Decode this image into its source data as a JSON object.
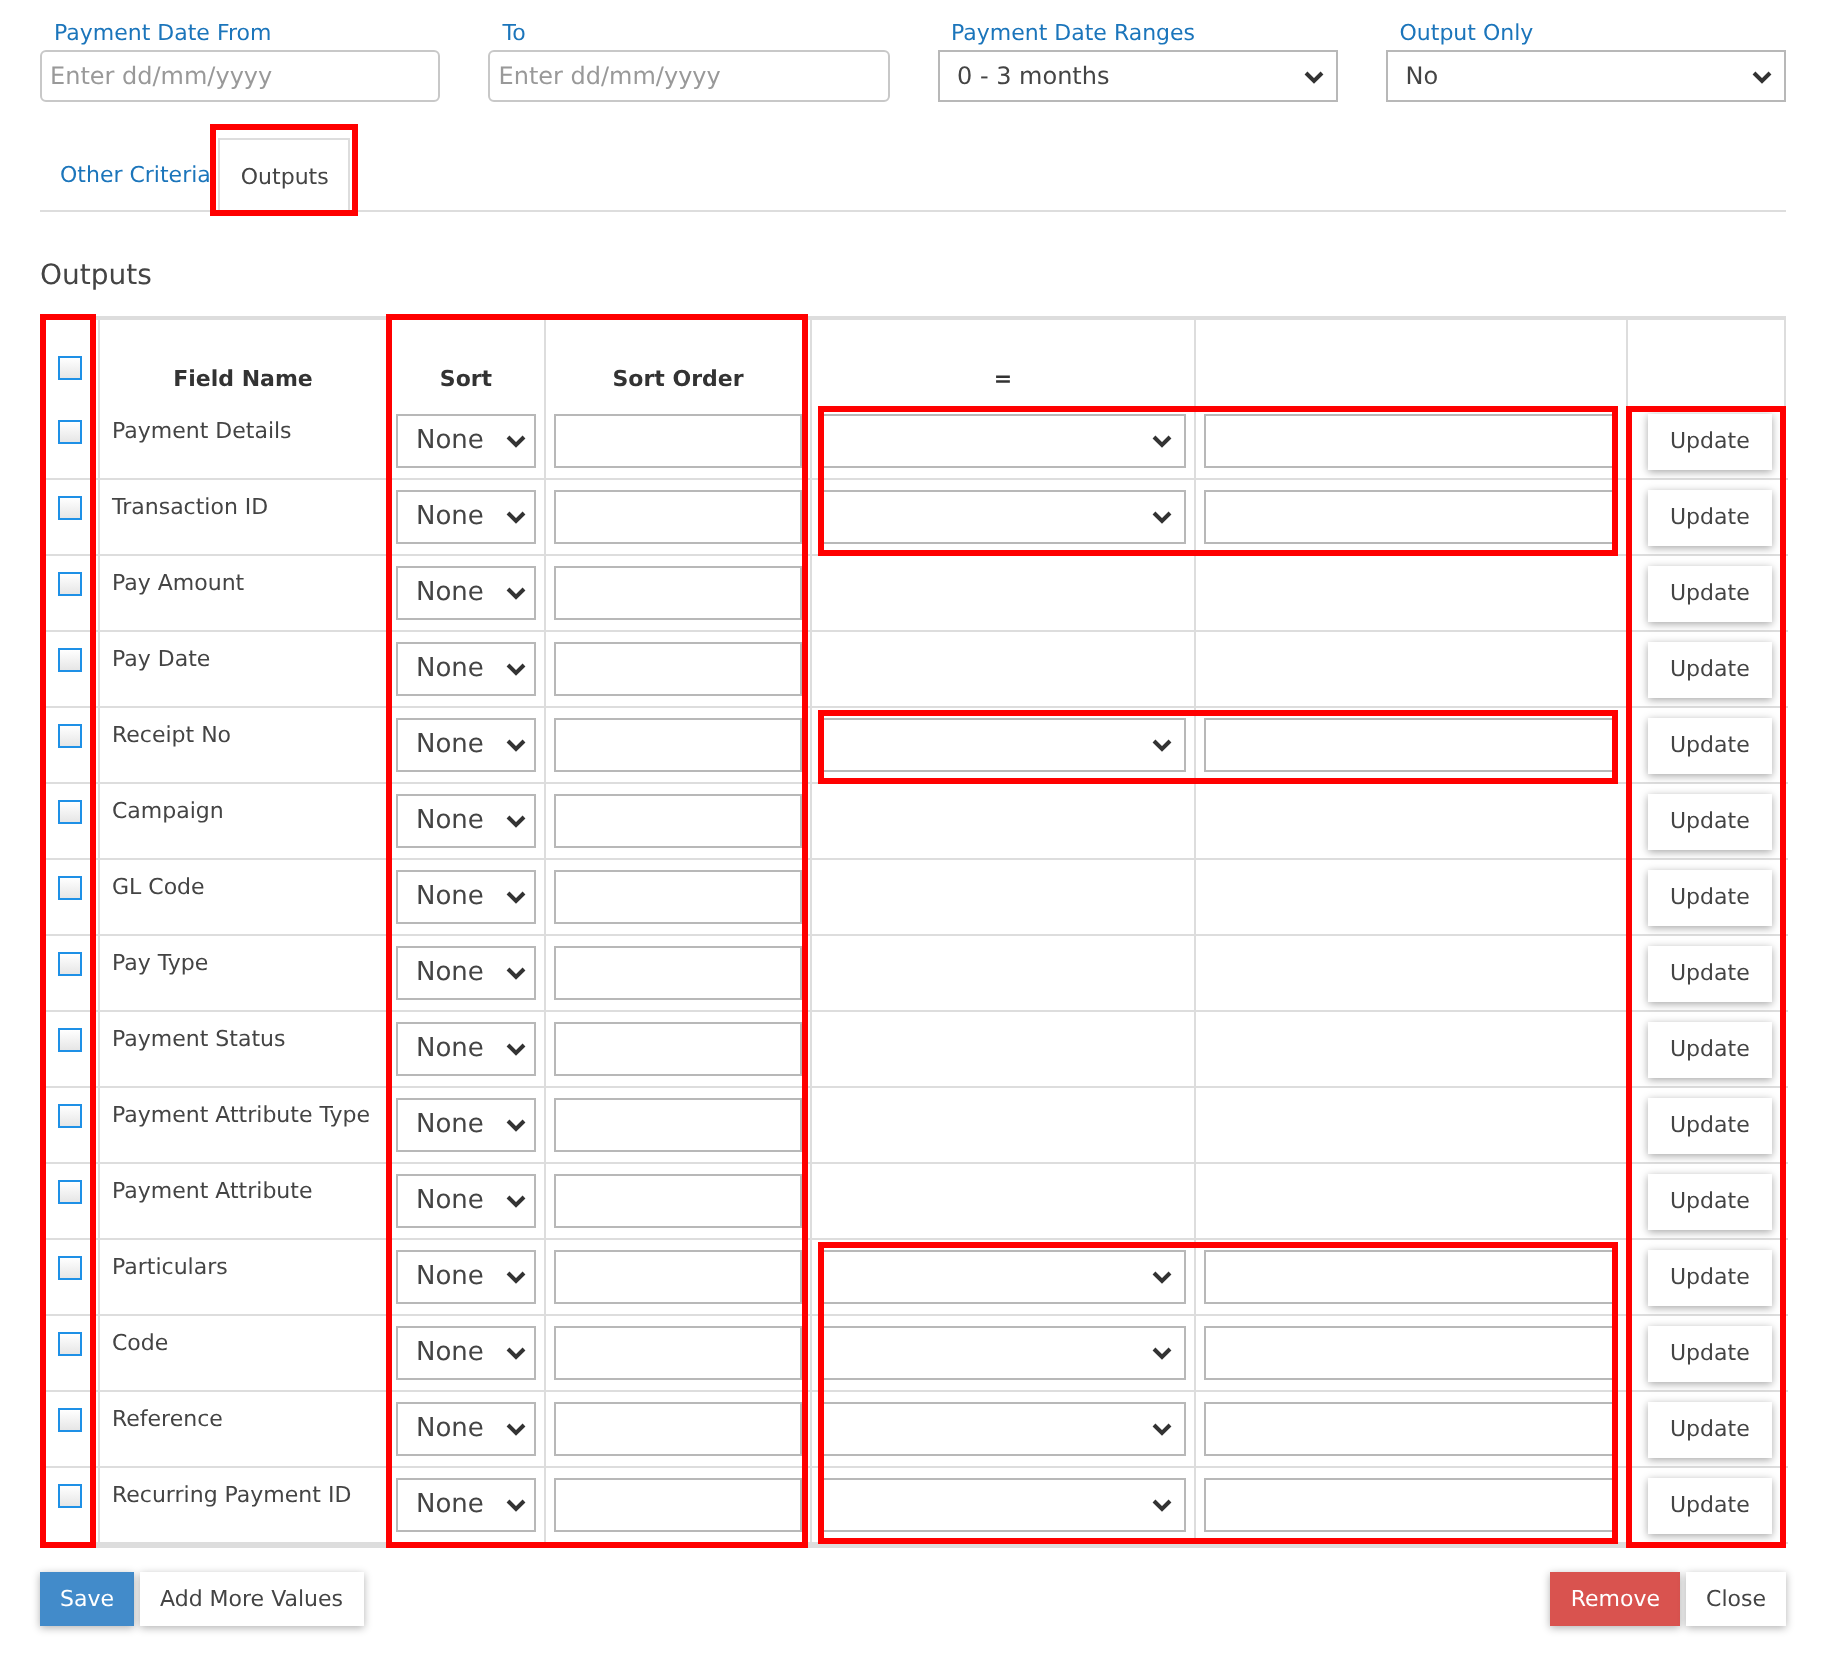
{
  "criteria": [
    {
      "label": "Payment Date From",
      "kind": "date",
      "placeholder": "Enter dd/mm/yyyy"
    },
    {
      "label": "To",
      "kind": "date",
      "placeholder": "Enter dd/mm/yyyy"
    },
    {
      "label": "Payment Date Ranges",
      "kind": "select",
      "value": "0 - 3 months"
    },
    {
      "label": "Output Only",
      "kind": "select",
      "value": "No"
    }
  ],
  "tabs": [
    {
      "label": "Other Criteria",
      "selected": false
    },
    {
      "label": "Outputs",
      "selected": true,
      "highlighted": true
    }
  ],
  "section_title": "Outputs",
  "columns": [
    {
      "kind": "checkbox",
      "checked": false,
      "highlighted": true
    },
    {
      "kind": "text",
      "label": "Field Name"
    },
    {
      "kind": "text",
      "label": "Sort",
      "highlighted": true
    },
    {
      "kind": "text",
      "label": "Sort Order",
      "highlighted": true
    },
    {
      "kind": "text",
      "label": "="
    },
    {
      "kind": "empty"
    },
    {
      "kind": "empty",
      "highlighted": true
    }
  ],
  "highlight_filter_rows": true,
  "rows": [
    {
      "field": "Payment Details",
      "checked": false,
      "sort": "None",
      "filter": true,
      "action": "Update"
    },
    {
      "field": "Transaction ID",
      "checked": false,
      "sort": "None",
      "filter": true,
      "action": "Update"
    },
    {
      "field": "Pay Amount",
      "checked": false,
      "sort": "None",
      "filter": false,
      "action": "Update"
    },
    {
      "field": "Pay Date",
      "checked": false,
      "sort": "None",
      "filter": false,
      "action": "Update"
    },
    {
      "field": "Receipt No",
      "checked": false,
      "sort": "None",
      "filter": true,
      "action": "Update"
    },
    {
      "field": "Campaign",
      "checked": false,
      "sort": "None",
      "filter": false,
      "action": "Update"
    },
    {
      "field": "GL Code",
      "checked": false,
      "sort": "None",
      "filter": false,
      "action": "Update"
    },
    {
      "field": "Pay Type",
      "checked": false,
      "sort": "None",
      "filter": false,
      "action": "Update"
    },
    {
      "field": "Payment Status",
      "checked": false,
      "sort": "None",
      "filter": false,
      "action": "Update"
    },
    {
      "field": "Payment Attribute Type",
      "checked": false,
      "sort": "None",
      "filter": false,
      "action": "Update"
    },
    {
      "field": "Payment Attribute",
      "checked": false,
      "sort": "None",
      "filter": false,
      "action": "Update"
    },
    {
      "field": "Particulars",
      "checked": false,
      "sort": "None",
      "filter": true,
      "action": "Update"
    },
    {
      "field": "Code",
      "checked": false,
      "sort": "None",
      "filter": true,
      "action": "Update"
    },
    {
      "field": "Reference",
      "checked": false,
      "sort": "None",
      "filter": true,
      "action": "Update"
    },
    {
      "field": "Recurring Payment ID",
      "checked": false,
      "sort": "None",
      "filter": true,
      "action": "Update"
    }
  ],
  "footer_left": [
    {
      "label": "Save",
      "kind": "primary"
    },
    {
      "label": "Add More Values",
      "kind": "default"
    }
  ],
  "footer_right": [
    {
      "label": "Remove",
      "kind": "danger"
    },
    {
      "label": "Close",
      "kind": "default"
    }
  ]
}
